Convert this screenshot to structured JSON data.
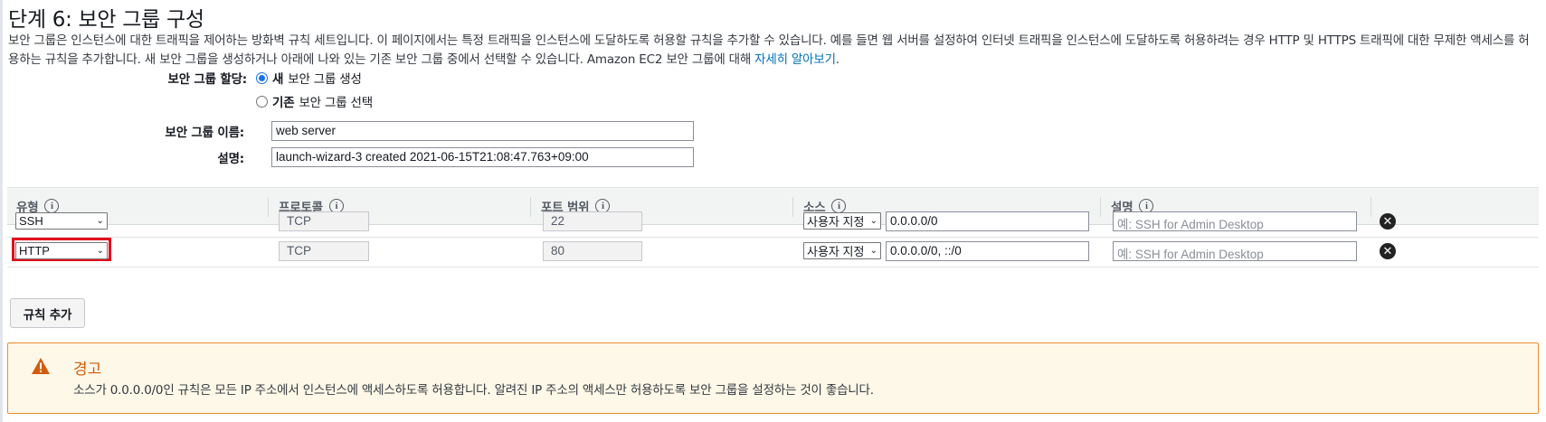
{
  "page": {
    "title": "단계 6: 보안 그룹 구성",
    "description_text": "보안 그룹은 인스턴스에 대한 트래픽을 제어하는 방화벽 규칙 세트입니다. 이 페이지에서는 특정 트래픽을 인스턴스에 도달하도록 허용할 규칙을 추가할 수 있습니다. 예를 들면 웹 서버를 설정하여 인터넷 트래픽을 인스턴스에 도달하도록 허용하려는 경우 HTTP 및 HTTPS 트래픽에 대한 무제한 액세스를 허용하는 규칙을 추가합니다. 새 보안 그룹을 생성하거나 아래에 나와 있는 기존 보안 그룹 중에서 선택할 수 있습니다. Amazon EC2 보안 그룹에 대해 ",
    "learn_more_link": "자세히 알아보기",
    "description_end": "."
  },
  "form": {
    "assign_label": "보안 그룹 할당:",
    "option_new_bold": "새",
    "option_new_rest": "보안 그룹 생성",
    "option_existing_bold": "기존",
    "option_existing_rest": "보안 그룹 선택",
    "selected_option": "new",
    "name_label": "보안 그룹 이름:",
    "name_value": "web server",
    "desc_label": "설명:",
    "desc_value": "launch-wizard-3 created 2021-06-15T21:08:47.763+09:00"
  },
  "table": {
    "headers": {
      "type": "유형",
      "protocol": "프로토콜",
      "port": "포트 범위",
      "source": "소스",
      "description": "설명"
    },
    "info_glyph": "i",
    "delete_glyph": "✕",
    "rows": [
      {
        "type": "SSH",
        "protocol": "TCP",
        "port": "22",
        "source_select": "사용자 지정",
        "source_value": "0.0.0.0/0",
        "description_placeholder": "예: SSH for Admin Desktop"
      },
      {
        "type": "HTTP",
        "protocol": "TCP",
        "port": "80",
        "source_select": "사용자 지정",
        "source_value": "0.0.0.0/0, ::/0",
        "description_placeholder": "예: SSH for Admin Desktop"
      }
    ]
  },
  "add_rule_label": "규칙 추가",
  "warning": {
    "title": "경고",
    "text": "소스가 0.0.0.0/0인 규칙은 모든 IP 주소에서 인스턴스에 액세스하도록 허용합니다. 알려진 IP 주소의 액세스만 허용하도록 보안 그룹을 설정하는 것이 좋습니다.",
    "icon": "warning-icon"
  },
  "colors": {
    "link": "#0073bb",
    "warning_border": "#eb8c2b",
    "warning_title": "#d45b07",
    "highlight": "#e3101b"
  }
}
